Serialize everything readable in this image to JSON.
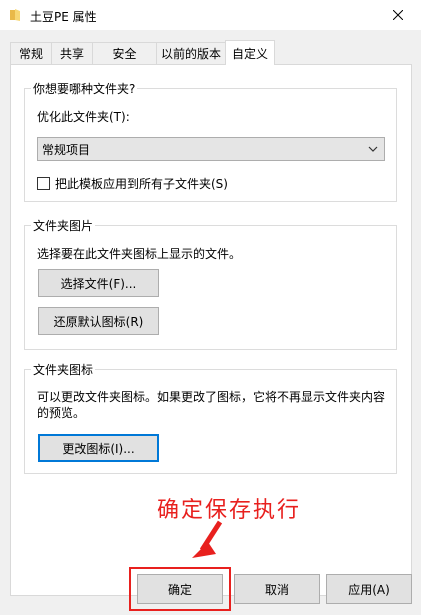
{
  "window": {
    "title": "土豆PE 属性"
  },
  "tabs": [
    {
      "label": "常规"
    },
    {
      "label": "共享"
    },
    {
      "label": "安全"
    },
    {
      "label": "以前的版本"
    },
    {
      "label": "自定义"
    }
  ],
  "optimize_group": {
    "label": "你想要哪种文件夹?",
    "field_label": "优化此文件夹(T):",
    "selected": "常规项目",
    "checkbox_label": "把此模板应用到所有子文件夹(S)",
    "checkbox_checked": false
  },
  "picture_group": {
    "label": "文件夹图片",
    "description": "选择要在此文件夹图标上显示的文件。",
    "choose_button": "选择文件(F)...",
    "restore_button": "还原默认图标(R)"
  },
  "icon_group": {
    "label": "文件夹图标",
    "description_line1": "可以更改文件夹图标。如果更改了图标，它将不再显示文件夹内容",
    "description_line2": "的预览。",
    "change_button": "更改图标(I)..."
  },
  "footer": {
    "ok": "确定",
    "cancel": "取消",
    "apply": "应用(A)"
  },
  "annotation": {
    "text": "确定保存执行",
    "color": "#e8201e"
  }
}
